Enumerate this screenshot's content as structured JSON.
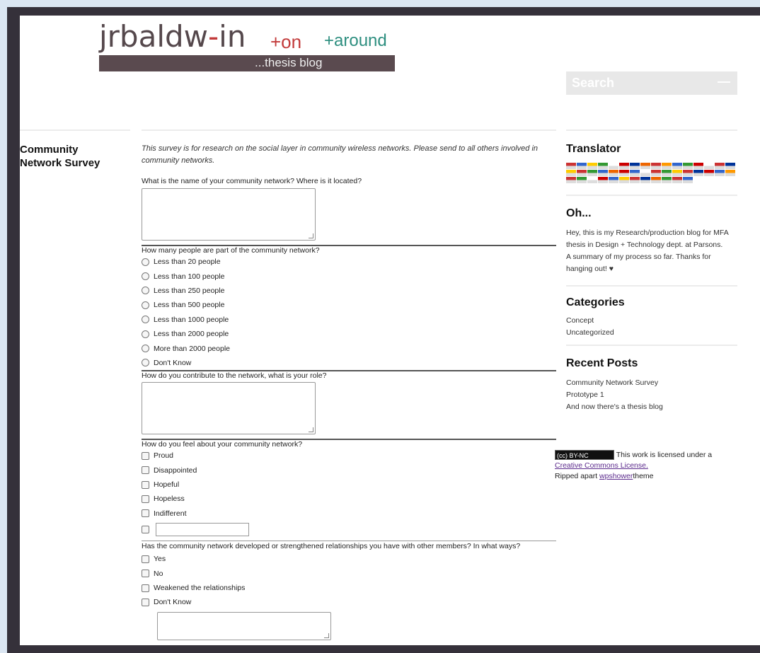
{
  "header": {
    "logo_main": "jrbaldw",
    "logo_dash": "-",
    "logo_main2": "in",
    "logo_on": "+on",
    "logo_around": "+around",
    "logo_sub": "...thesis blog",
    "search_placeholder": "Search",
    "search_button": "—"
  },
  "post": {
    "title": "Community Network Survey",
    "intro": "This survey is for research on the social layer in community wireless networks. Please send to all others involved in community networks."
  },
  "survey": {
    "q1": "What is the name of your community network? Where is it located?",
    "q2": "How many people are part of the community network?",
    "q2_options": [
      "Less than 20 people",
      "Less than 100 people",
      "Less than 250 people",
      "Less than 500 people",
      "Less than 1000 people",
      "Less than 2000 people",
      "More than 2000 people",
      "Don't Know"
    ],
    "q3": "How do you contribute to the network, what is your role?",
    "q4": "How do you feel about your community network?",
    "q4_options": [
      "Proud",
      "Disappointed",
      "Hopeful",
      "Hopeless",
      "Indifferent"
    ],
    "q5": "Has the community network developed or strengthened relationships you have with other members? In what ways?",
    "q5_options": [
      "Yes",
      "No",
      "Weakened the relationships",
      "Don't Know"
    ]
  },
  "sidebar": {
    "translator_title": "Translator",
    "oh_title": "Oh...",
    "oh_text1": "Hey, this is my Research/production blog for MFA thesis in Design + Technology dept. at Parsons.",
    "oh_text2": "A summary of my process so far. Thanks for hanging out! ♥",
    "categories_title": "Categories",
    "categories": [
      "Concept",
      "Uncategorized"
    ],
    "recent_title": "Recent Posts",
    "recent": [
      "Community Network Survey",
      "Prototype 1",
      "And now there's a thesis blog"
    ],
    "license_text": "This work is licensed under a",
    "license_link": "Creative Commons License.",
    "ripped": "Ripped apart",
    "ripped_link": "wpshower",
    "ripped_end": "theme",
    "cc_badge": "(cc) BY-NC"
  },
  "flag_colors": [
    "#c33",
    "#36c",
    "#fc0",
    "#393",
    "#fff",
    "#c00",
    "#039",
    "#e60",
    "#c33",
    "#f90",
    "#36c",
    "#393",
    "#c00",
    "#fff",
    "#c33",
    "#039",
    "#fc0",
    "#c33",
    "#393",
    "#36c",
    "#e60",
    "#c00",
    "#36c",
    "#fff",
    "#c33",
    "#393",
    "#fc0",
    "#c33",
    "#039",
    "#c00",
    "#36c",
    "#f90",
    "#c33",
    "#393",
    "#fff",
    "#c00",
    "#36c",
    "#fc0",
    "#c33",
    "#039",
    "#e60",
    "#393",
    "#c33",
    "#36c"
  ]
}
